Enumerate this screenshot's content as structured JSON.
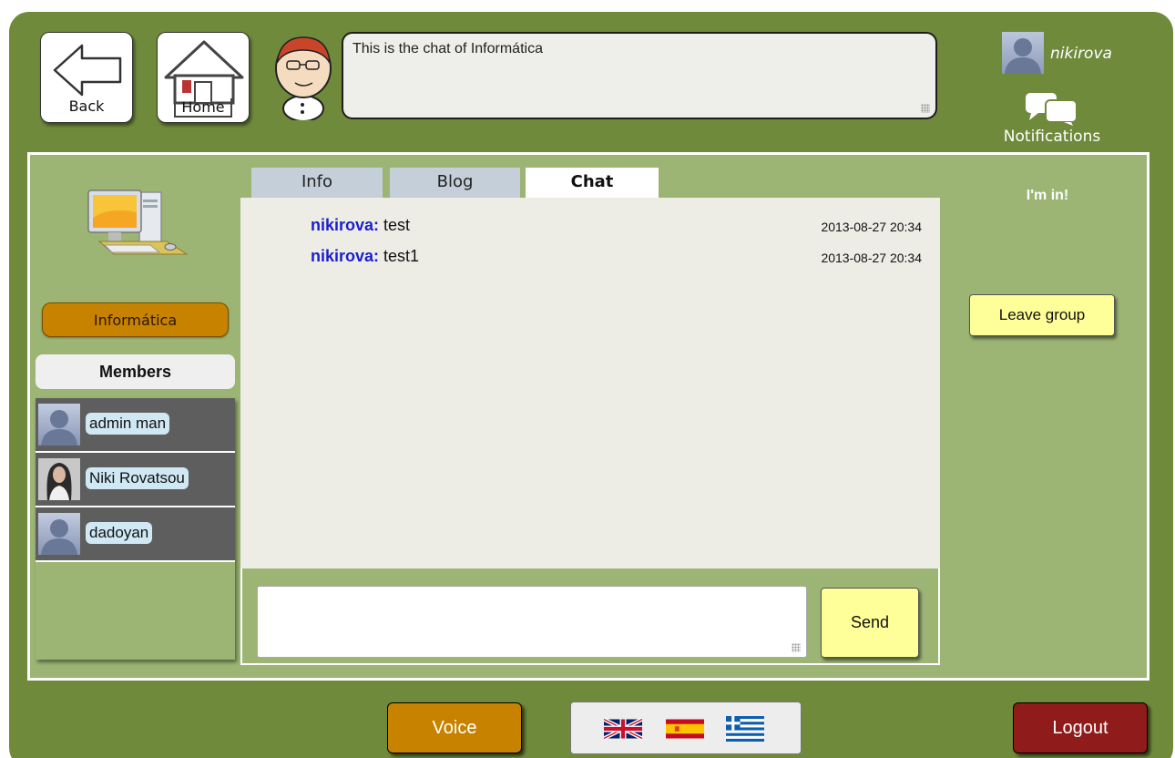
{
  "header": {
    "back_label": "Back",
    "home_label": "Home",
    "speech_text": "This is the chat of Informática",
    "username": "nikirova",
    "notifications_label": "Notifications"
  },
  "group": {
    "name": "Informática",
    "members_title": "Members",
    "members": [
      {
        "name": "admin man",
        "avatar": "default-avatar"
      },
      {
        "name": "Niki Rovatsou",
        "avatar": "photo-avatar"
      },
      {
        "name": "dadoyan",
        "avatar": "default-avatar"
      }
    ]
  },
  "tabs": [
    {
      "label": "Info",
      "active": false
    },
    {
      "label": "Blog",
      "active": false
    },
    {
      "label": "Chat",
      "active": true
    }
  ],
  "chat": {
    "messages": [
      {
        "user": "nikirova:",
        "text": " test",
        "time": "2013-08-27 20:34"
      },
      {
        "user": "nikirova:",
        "text": " test1",
        "time": "2013-08-27 20:34"
      }
    ],
    "input_value": "",
    "send_label": "Send"
  },
  "sidebar_right": {
    "status": "I'm in!",
    "leave_label": "Leave group"
  },
  "footer": {
    "voice_label": "Voice",
    "languages": [
      "uk-flag-icon",
      "spain-flag-icon",
      "greece-flag-icon"
    ],
    "logout_label": "Logout"
  },
  "colors": {
    "frame": "#6f8a3b",
    "panel": "#9cb574",
    "accent_orange": "#c78300",
    "button_yellow": "#ffff99",
    "logout_red": "#8f1b1b",
    "chat_user": "#1a1fcc"
  }
}
